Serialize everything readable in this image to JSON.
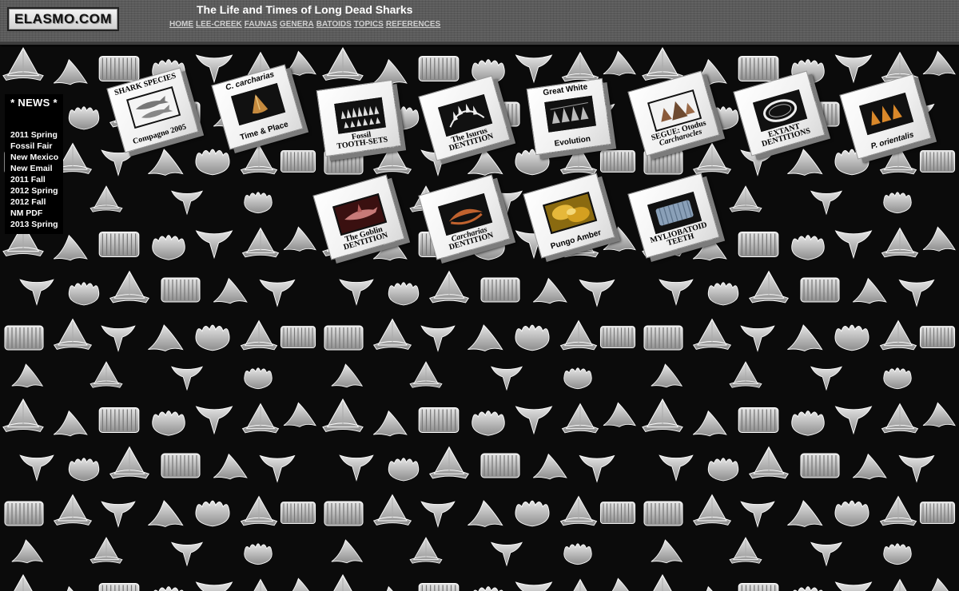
{
  "header": {
    "logo_text": "ELASMO.COM",
    "title": "The Life and Times of Long Dead Sharks",
    "nav": [
      "HOME",
      "LEE-CREEK",
      "FAUNAS",
      "GENERA",
      "BATOIDS",
      "TOPICS",
      "REFERENCES"
    ]
  },
  "news": {
    "heading": "* NEWS *",
    "items": [
      "2011 Spring",
      "Fossil Fair",
      "New Mexico",
      "New Email",
      "2011 Fall",
      "2012 Spring",
      "2012 Fall",
      "NM PDF",
      "2013 Spring"
    ]
  },
  "tiles": [
    {
      "top": "SHARK SPECIES",
      "bottom": "Compagno 2005",
      "icon": "shark-species-icon"
    },
    {
      "top": "C. carcharias",
      "bottom": "Time & Place",
      "icon": "great-white-tooth-icon"
    },
    {
      "top": "",
      "bottom": "Fossil",
      "bottom2": "TOOTH-SETS",
      "icon": "tooth-set-icon"
    },
    {
      "top": "",
      "bottom": "The Isurus",
      "bottom2": "DENTITION",
      "icon": "isurus-jaw-icon"
    },
    {
      "top": "Great White",
      "bottom": "Evolution",
      "icon": "evolution-teeth-icon"
    },
    {
      "top": "",
      "bottom": "SEGUE: Otodus",
      "bottom2": "Carcharocles",
      "icon": "otodus-tooth-icon"
    },
    {
      "top": "",
      "bottom": "EXTANT",
      "bottom2": "DENTITIONS",
      "icon": "shark-jaw-icon"
    },
    {
      "top": "",
      "bottom": "P. orientalis",
      "icon": "orientalis-teeth-icon"
    },
    {
      "top": "",
      "bottom": "The Goblin",
      "bottom2": "DENTITION",
      "icon": "goblin-shark-icon"
    },
    {
      "top": "",
      "bottom": "Carcharias",
      "bottom2": "DENTITION",
      "icon": "carcharias-jaw-icon"
    },
    {
      "top": "",
      "bottom": "Pungo Amber",
      "icon": "amber-icon"
    },
    {
      "top": "",
      "bottom": "MYLIOBATOID",
      "bottom2": "TEETH",
      "icon": "ray-teeth-icon"
    }
  ],
  "colors": {
    "header_bg": "#5a5a5a",
    "page_bg": "#0b0b0b",
    "nav_link": "#cfcfcf",
    "tile_face": "#f0f0f0"
  }
}
